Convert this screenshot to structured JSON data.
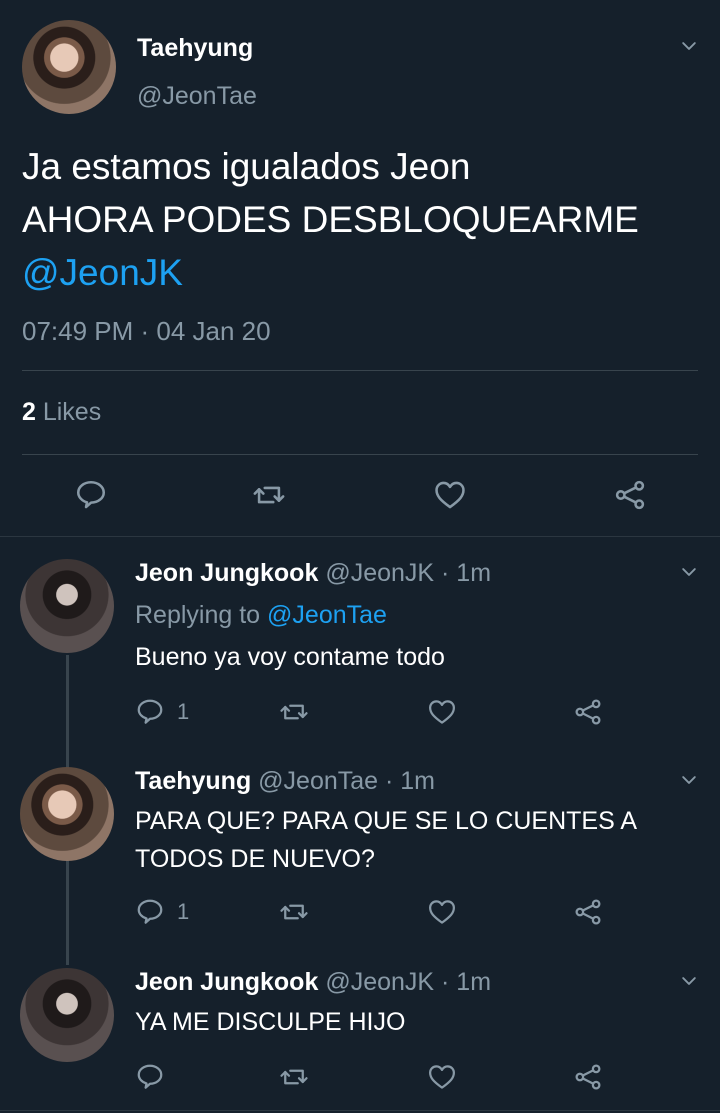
{
  "main_tweet": {
    "author_name": "Taehyung",
    "author_handle": "@JeonTae",
    "text_line1": "Ja estamos igualados Jeon",
    "text_line2": "AHORA PODES DESBLOQUEARME",
    "mention": "@JeonJK",
    "timestamp": "07:49 PM · 04 Jan 20",
    "likes_count": "2",
    "likes_label": " Likes"
  },
  "replies": [
    {
      "author_name": "Jeon Jungkook",
      "meta": " @JeonJK · 1m",
      "replying_prefix": "Replying to ",
      "replying_handle": "@JeonTae",
      "text": "Bueno ya voy contame todo",
      "reply_count": "1"
    },
    {
      "author_name": "Taehyung",
      "meta": " @JeonTae · 1m",
      "text_line1": "PARA QUE? PARA QUE SE LO CUENTES A",
      "text_line2": "TODOS DE NUEVO?",
      "reply_count": "1"
    },
    {
      "author_name": "Jeon Jungkook",
      "meta": " @JeonJK · 1m",
      "text": "YA ME DISCULPE HIJO",
      "reply_count": ""
    }
  ],
  "icons": {
    "reply": "reply-icon",
    "retweet": "retweet-icon",
    "like": "heart-icon",
    "share": "share-icon",
    "menu": "chevron-down-icon"
  },
  "colors": {
    "background": "#15202b",
    "link": "#1da1f2",
    "muted": "#8899a6",
    "divider": "#38444d"
  }
}
